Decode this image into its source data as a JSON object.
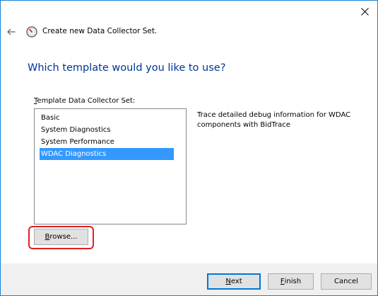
{
  "wizard": {
    "title": "Create new Data Collector Set.",
    "heading": "Which template would you like to use?"
  },
  "template_list": {
    "label_mnemonic": "T",
    "label_rest": "emplate Data Collector Set:",
    "items": [
      {
        "label": "Basic",
        "selected": false
      },
      {
        "label": "System Diagnostics",
        "selected": false
      },
      {
        "label": "System Performance",
        "selected": false
      },
      {
        "label": "WDAC Diagnostics",
        "selected": true
      }
    ]
  },
  "description": "Trace detailed debug information for WDAC components with BidTrace",
  "buttons": {
    "browse_mnemonic": "B",
    "browse_rest": "rowse...",
    "next_mnemonic": "N",
    "next_rest": "ext",
    "finish_mnemonic": "F",
    "finish_rest": "inish",
    "cancel_label": "Cancel"
  },
  "icons": {
    "close": "close-icon",
    "back": "back-arrow-icon",
    "wizard": "performance-monitor-icon"
  },
  "colors": {
    "heading": "#003399",
    "selection": "#3399ff",
    "highlight_ring": "#e0201f",
    "default_button_border": "#0078d7"
  }
}
